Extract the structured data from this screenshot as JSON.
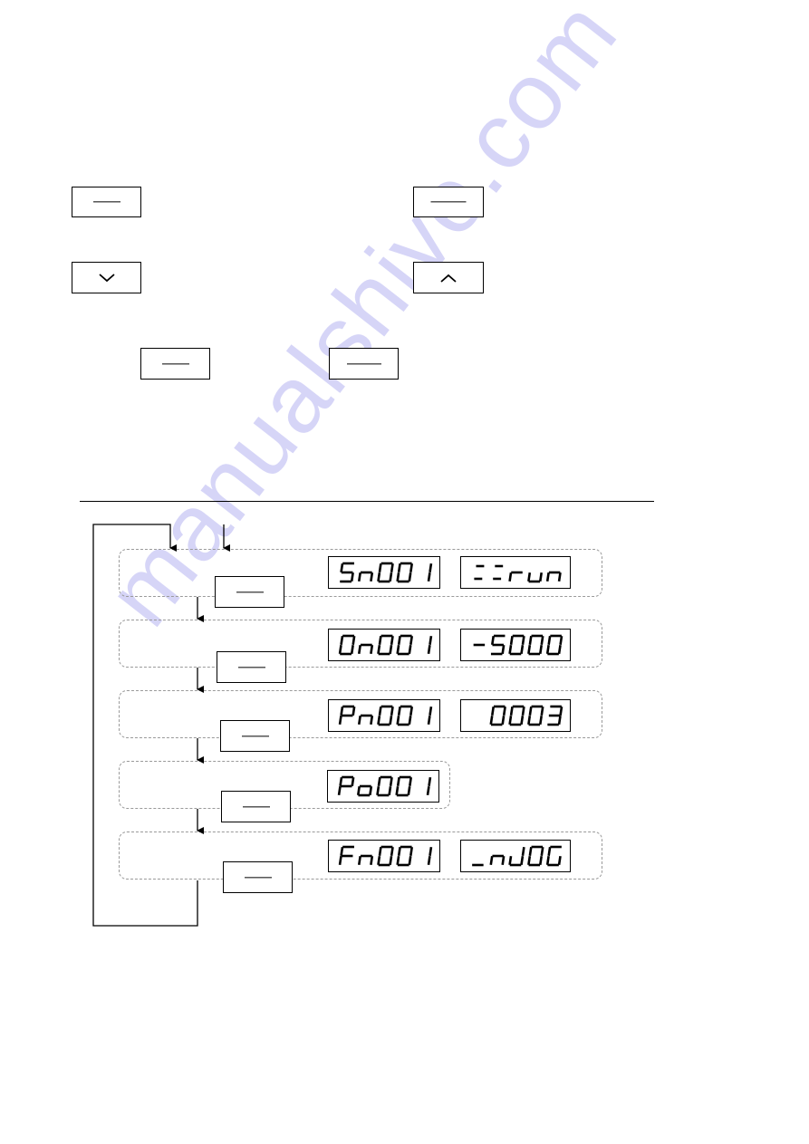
{
  "watermark": "manualshive.com",
  "keys_top": [
    {
      "name": "key-1",
      "glyph": "blank-label"
    },
    {
      "name": "key-2",
      "glyph": "blank-label"
    },
    {
      "name": "key-down",
      "glyph": "chevron-down-icon"
    },
    {
      "name": "key-up",
      "glyph": "chevron-up-icon"
    },
    {
      "name": "key-3",
      "glyph": "blank-label"
    },
    {
      "name": "key-4",
      "glyph": "blank-label"
    }
  ],
  "flow": {
    "rows": [
      {
        "id": "status",
        "code": "Sn001",
        "value": "==run",
        "key_glyph": "blank-label"
      },
      {
        "id": "monitor",
        "code": "On001",
        "value": "-5000",
        "key_glyph": "blank-label"
      },
      {
        "id": "parameter",
        "code": "Pn001",
        "value": "0003",
        "key_glyph": "blank-label"
      },
      {
        "id": "position",
        "code": "Po001",
        "value": null,
        "key_glyph": "blank-label"
      },
      {
        "id": "function",
        "code": "Fn001",
        "value": "_nJOG",
        "key_glyph": "blank-label"
      }
    ]
  },
  "colors": {
    "line": "#000000",
    "group_border": "#9a9a9a",
    "watermark": "#c9c8f5"
  }
}
